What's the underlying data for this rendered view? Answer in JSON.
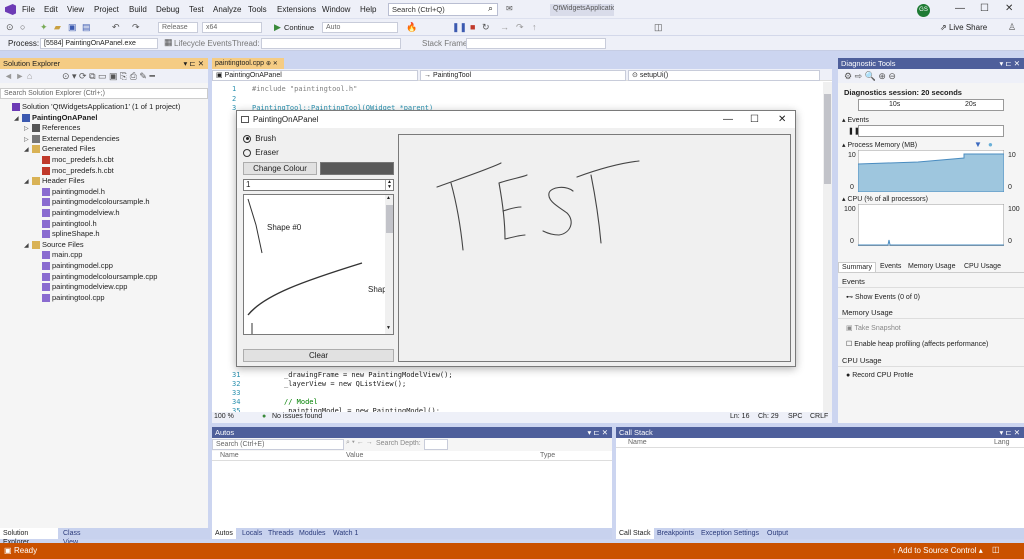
{
  "menubar": {
    "items": [
      "File",
      "Edit",
      "View",
      "Project",
      "Build",
      "Debug",
      "Test",
      "Analyze",
      "Tools",
      "Extensions",
      "Window",
      "Help"
    ],
    "search_placeholder": "Search (Ctrl+Q)",
    "solution_name": "QtWidgetsApplication1",
    "avatar": "GS",
    "live_share": "Live Share"
  },
  "toolbar": {
    "config": "Release",
    "platform": "x64",
    "continue": "Continue",
    "auto": "Auto",
    "process_label": "Process:",
    "process_value": "[5584] PaintingOnAPanel.exe",
    "lifecycle": "Lifecycle Events",
    "thread_label": "Thread:",
    "stackframe_label": "Stack Frame:"
  },
  "solution_explorer": {
    "title": "Solution Explorer",
    "search_placeholder": "Search Solution Explorer (Ctrl+;)",
    "tree": [
      {
        "label": "Solution 'QtWidgetsApplication1' (1 of 1 project)",
        "indent": 0,
        "icon": "sln"
      },
      {
        "label": "PaintingOnAPanel",
        "indent": 1,
        "icon": "proj",
        "bold": true
      },
      {
        "label": "References",
        "indent": 2,
        "icon": "ref"
      },
      {
        "label": "External Dependencies",
        "indent": 2,
        "icon": "ext"
      },
      {
        "label": "Generated Files",
        "indent": 2,
        "icon": "folder"
      },
      {
        "label": "moc_predefs.h.cbt",
        "indent": 3,
        "icon": "cbt"
      },
      {
        "label": "moc_predefs.h.cbt",
        "indent": 3,
        "icon": "cbt"
      },
      {
        "label": "Header Files",
        "indent": 2,
        "icon": "folder"
      },
      {
        "label": "paintingmodel.h",
        "indent": 3,
        "icon": "h"
      },
      {
        "label": "paintingmodelcoloursample.h",
        "indent": 3,
        "icon": "h"
      },
      {
        "label": "paintingmodelview.h",
        "indent": 3,
        "icon": "h"
      },
      {
        "label": "paintingtool.h",
        "indent": 3,
        "icon": "h"
      },
      {
        "label": "splineShape.h",
        "indent": 3,
        "icon": "h"
      },
      {
        "label": "Source Files",
        "indent": 2,
        "icon": "folder"
      },
      {
        "label": "main.cpp",
        "indent": 3,
        "icon": "cpp"
      },
      {
        "label": "paintingmodel.cpp",
        "indent": 3,
        "icon": "cpp"
      },
      {
        "label": "paintingmodelcoloursample.cpp",
        "indent": 3,
        "icon": "cpp"
      },
      {
        "label": "paintingmodelview.cpp",
        "indent": 3,
        "icon": "cpp"
      },
      {
        "label": "paintingtool.cpp",
        "indent": 3,
        "icon": "cpp"
      }
    ],
    "bottom_tabs": [
      "Solution Explorer",
      "Class View"
    ]
  },
  "editor": {
    "tab": "paintingtool.cpp",
    "nav1": "PaintingOnAPanel",
    "nav2": "PaintingTool",
    "nav3": "setupUi()",
    "lines": [
      {
        "n": "1",
        "code": "#include \"paintingtool.h\""
      },
      {
        "n": "2",
        "code": ""
      },
      {
        "n": "3",
        "code": "PaintingTool::PaintingTool(QWidget *parent)"
      }
    ],
    "lines_bottom": [
      {
        "n": "31",
        "code": "_drawingFrame = new PaintingModelView();"
      },
      {
        "n": "32",
        "code": "_layerView = new QListView();"
      },
      {
        "n": "33",
        "code": ""
      },
      {
        "n": "34",
        "code": "// Model"
      },
      {
        "n": "35",
        "code": "_paintingModel = new PaintingModel();"
      }
    ],
    "zoom": "100 %",
    "issues": "No issues found",
    "ln": "Ln: 16",
    "ch": "Ch: 29",
    "spc": "SPC",
    "crlf": "CRLF"
  },
  "dialog": {
    "title": "PaintingOnAPanel",
    "brush": "Brush",
    "eraser": "Eraser",
    "change_colour": "Change Colour",
    "swatch_color": "#595959",
    "spin_value": "1",
    "shape0": "Shape #0",
    "shape1": "Shap",
    "clear": "Clear"
  },
  "diagnostics": {
    "title": "Diagnostic Tools",
    "session": "Diagnostics session: 20 seconds",
    "t10": "10s",
    "t20": "20s",
    "events": "Events",
    "process_memory": "Process Memory (MB)",
    "mem_max": "10",
    "mem_min": "0",
    "cpu": "CPU (% of all processors)",
    "cpu_max": "100",
    "cpu_min": "0",
    "tabs": [
      "Summary",
      "Events",
      "Memory Usage",
      "CPU Usage"
    ],
    "events_header": "Events",
    "show_events": "Show Events (0 of 0)",
    "memory_usage": "Memory Usage",
    "take_snapshot": "Take Snapshot",
    "heap_profiling": "Enable heap profiling (affects performance)",
    "cpu_usage": "CPU Usage",
    "record_cpu": "Record CPU Profile"
  },
  "autos": {
    "title": "Autos",
    "search_placeholder": "Search (Ctrl+E)",
    "search_depth": "Search Depth:",
    "cols": [
      "Name",
      "Value",
      "Type"
    ],
    "tabs": [
      "Autos",
      "Locals",
      "Threads",
      "Modules",
      "Watch 1"
    ]
  },
  "callstack": {
    "title": "Call Stack",
    "cols": [
      "Name",
      "Lang"
    ],
    "tabs": [
      "Call Stack",
      "Breakpoints",
      "Exception Settings",
      "Output"
    ]
  },
  "status": {
    "ready": "Ready",
    "source_control": "Add to Source Control"
  }
}
